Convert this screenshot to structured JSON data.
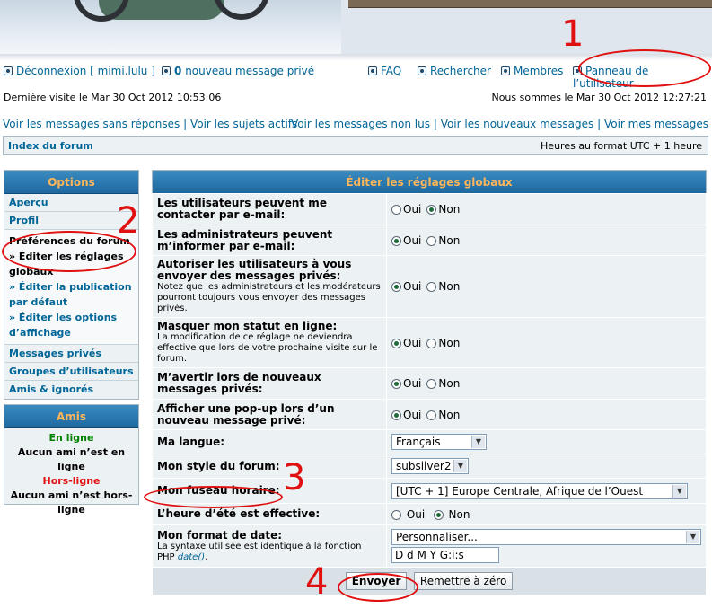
{
  "nav": {
    "logout": "Déconnexion [ mimi.lulu ]",
    "new_messages_count": "0",
    "new_messages_label": "nouveau message privé",
    "faq": "FAQ",
    "search": "Rechercher",
    "members": "Membres",
    "user_panel": "Panneau de l’utilisateur"
  },
  "info": {
    "last_visit": "Dernière visite le Mar 30 Oct 2012 10:53:06",
    "now": "Nous sommes le Mar 30 Oct 2012 12:27:21"
  },
  "links": {
    "unanswered": "Voir les messages sans réponses",
    "active": "Voir les sujets actifs",
    "unread": "Voir les messages non lus",
    "new_posts": "Voir les nouveaux messages",
    "my_posts": "Voir mes messages",
    "sep": "|"
  },
  "breadcrumb": {
    "forum_index": "Index du forum",
    "timezone": "Heures au format UTC + 1 heure"
  },
  "sidebar": {
    "title": "Options",
    "overview": "Aperçu",
    "profile": "Profil",
    "prefs_title": "Préférences du forum",
    "prefs_global": "» Éditer les réglages globaux",
    "prefs_posting": "» Éditer la publication par défaut",
    "prefs_display": "» Éditer les options d’affichage",
    "private_messages": "Messages privés",
    "user_groups": "Groupes d’utilisateurs",
    "friends_foes": "Amis & ignorés"
  },
  "friends": {
    "title": "Amis",
    "online": "En ligne",
    "online_none": "Aucun ami n’est en ligne",
    "offline": "Hors-ligne",
    "offline_none": "Aucun ami n’est hors-ligne"
  },
  "form": {
    "title": "Éditer les réglages globaux",
    "yes": "Oui",
    "no": "Non",
    "rows": [
      {
        "label": "Les utilisateurs peuvent me contacter par e-mail:",
        "desc": "",
        "selected": "no"
      },
      {
        "label": "Les administrateurs peuvent m’informer par e-mail:",
        "desc": "",
        "selected": "yes"
      },
      {
        "label": "Autoriser les utilisateurs à vous envoyer des messages privés:",
        "desc": "Notez que les administrateurs et les modérateurs pourront toujours vous envoyer des messages privés.",
        "selected": "yes"
      },
      {
        "label": "Masquer mon statut en ligne:",
        "desc": "La modification de ce réglage ne deviendra effective que lors de votre prochaine visite sur le forum.",
        "selected": "yes"
      },
      {
        "label": "M’avertir lors de nouveaux messages privés:",
        "desc": "",
        "selected": "yes"
      },
      {
        "label": "Afficher une pop-up lors d’un nouveau message privé:",
        "desc": "",
        "selected": "yes"
      }
    ],
    "language_label": "Ma langue:",
    "language_value": "Français",
    "style_label": "Mon style du forum:",
    "style_value": "subsilver2",
    "timezone_label": "Mon fuseau horaire:",
    "timezone_value": "[UTC + 1] Europe Centrale, Afrique de l’Ouest",
    "dst_label": "L’heure d’été est effective:",
    "dst_selected": "no",
    "dateformat_label": "Mon format de date:",
    "dateformat_desc_pre": "La syntaxe utilisée est identique à la fonction PHP",
    "dateformat_desc_fn": "date()",
    "dateformat_desc_post": ".",
    "dateformat_select": "Personnaliser...",
    "dateformat_value": "D d M Y G:i:s",
    "submit": "Envoyer",
    "reset": "Remettre à zéro"
  },
  "annotations": {
    "n1": "1",
    "n2": "2",
    "n3": "3",
    "n4": "4"
  },
  "colors": {
    "accent": "#006597",
    "header_text": "#ffb55a",
    "annotation": "#e01010",
    "online": "#008000",
    "offline": "#e01010"
  }
}
